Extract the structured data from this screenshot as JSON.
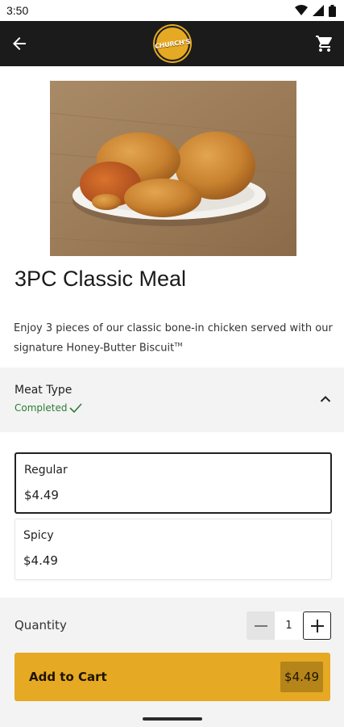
{
  "status_bar": {
    "time": "3:50"
  },
  "app_bar": {
    "logo_text": "CHURCH'S"
  },
  "product": {
    "title": "3PC Classic Meal",
    "description": "Enjoy 3 pieces of our classic bone-in chicken served with our signature Honey-Butter Biscuit",
    "trademark": "TM"
  },
  "option_group": {
    "title": "Meat Type",
    "status": "Completed",
    "options": [
      {
        "name": "Regular",
        "price": "$4.49",
        "selected": true
      },
      {
        "name": "Spicy",
        "price": "$4.49",
        "selected": false
      }
    ]
  },
  "quantity": {
    "label": "Quantity",
    "value": "1"
  },
  "add_to_cart": {
    "label": "Add to Cart",
    "price": "$4.49"
  },
  "colors": {
    "accent": "#e5a924",
    "app_bar": "#1b1b1b",
    "completed": "#2e7d32"
  },
  "icons": [
    "back-arrow-icon",
    "cart-icon",
    "chevron-up-icon",
    "check-icon",
    "minus-icon",
    "plus-icon",
    "wifi-icon",
    "signal-icon",
    "battery-icon"
  ]
}
